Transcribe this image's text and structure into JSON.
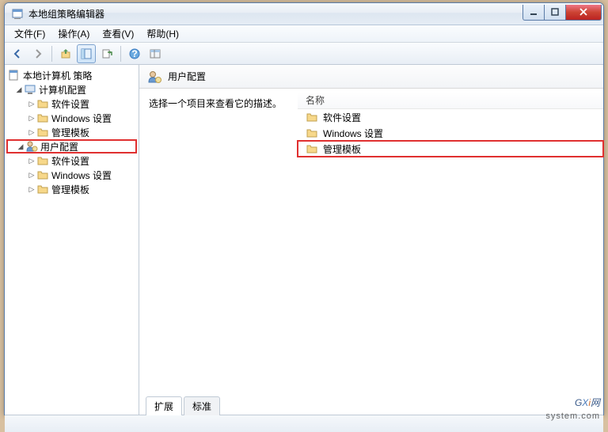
{
  "window": {
    "title": "本地组策略编辑器"
  },
  "menu": {
    "file": "文件(F)",
    "action": "操作(A)",
    "view": "查看(V)",
    "help": "帮助(H)"
  },
  "tree": {
    "root": "本地计算机 策略",
    "computer_config": "计算机配置",
    "cc_software": "软件设置",
    "cc_windows": "Windows 设置",
    "cc_templates": "管理模板",
    "user_config": "用户配置",
    "uc_software": "软件设置",
    "uc_windows": "Windows 设置",
    "uc_templates": "管理模板"
  },
  "detail": {
    "header": "用户配置",
    "prompt": "选择一个项目来查看它的描述。",
    "col_name": "名称",
    "items": {
      "software": "软件设置",
      "windows": "Windows 设置",
      "templates": "管理模板"
    }
  },
  "tabs": {
    "extended": "扩展",
    "standard": "标准"
  },
  "watermark": {
    "brand_g": "G",
    "brand_x": "X",
    "brand_i": "i",
    "brand_suffix": "网",
    "url": "system.com"
  }
}
